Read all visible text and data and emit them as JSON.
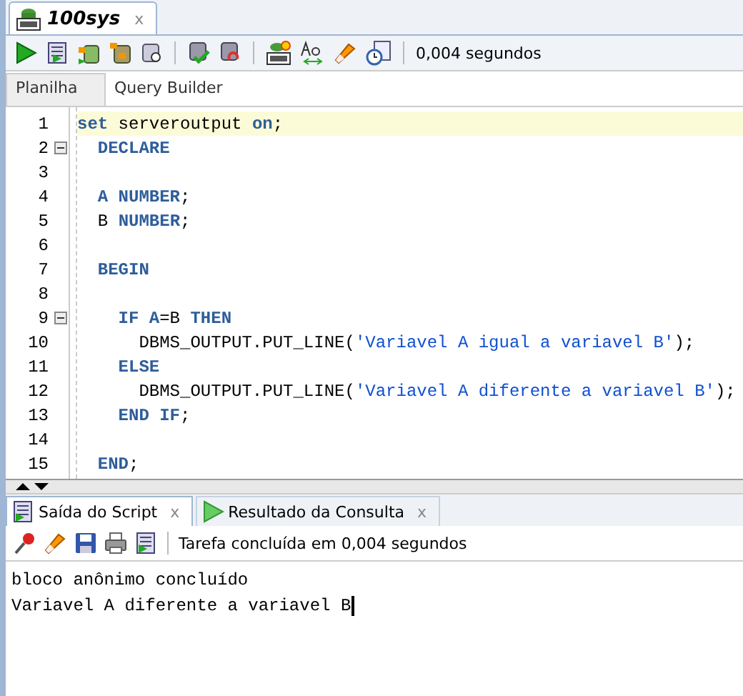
{
  "editor_tab": {
    "title": "100sys",
    "close": "x",
    "selected": true
  },
  "toolbar": {
    "timing": "0,004 segundos"
  },
  "sub_tabs": [
    {
      "label": "Planilha",
      "selected": true
    },
    {
      "label": "Query Builder",
      "selected": false
    }
  ],
  "code_lines": [
    {
      "number": "1",
      "fold": false,
      "highlighted": true,
      "tokens": [
        {
          "kind": "keyword",
          "text": "set"
        },
        {
          "kind": "text",
          "text": " serveroutput "
        },
        {
          "kind": "keyword",
          "text": "on"
        },
        {
          "kind": "text",
          "text": ";"
        }
      ]
    },
    {
      "number": "2",
      "fold": true,
      "highlighted": false,
      "tokens": [
        {
          "kind": "keyword",
          "text": "  DECLARE"
        }
      ]
    },
    {
      "number": "3",
      "fold": false,
      "highlighted": false
    },
    {
      "number": "4",
      "fold": false,
      "highlighted": false,
      "tokens": [
        {
          "kind": "keyword",
          "text": "  A NUMBER"
        },
        {
          "kind": "text",
          "text": ";"
        }
      ]
    },
    {
      "number": "5",
      "fold": false,
      "highlighted": false,
      "tokens": [
        {
          "kind": "text",
          "text": "  B "
        },
        {
          "kind": "keyword",
          "text": "NUMBER"
        },
        {
          "kind": "text",
          "text": ";"
        }
      ]
    },
    {
      "number": "6",
      "fold": false,
      "highlighted": false
    },
    {
      "number": "7",
      "fold": false,
      "highlighted": false,
      "tokens": [
        {
          "kind": "keyword",
          "text": "  BEGIN"
        }
      ]
    },
    {
      "number": "8",
      "fold": false,
      "highlighted": false
    },
    {
      "number": "9",
      "fold": true,
      "highlighted": false,
      "tokens": [
        {
          "kind": "keyword",
          "text": "    IF A"
        },
        {
          "kind": "text",
          "text": "=B "
        },
        {
          "kind": "keyword",
          "text": "THEN"
        }
      ]
    },
    {
      "number": "10",
      "fold": false,
      "highlighted": false,
      "tokens": [
        {
          "kind": "text",
          "text": "      DBMS_OUTPUT.PUT_LINE("
        },
        {
          "kind": "string",
          "text": "'Variavel A igual a variavel B'"
        },
        {
          "kind": "text",
          "text": ");"
        }
      ]
    },
    {
      "number": "11",
      "fold": false,
      "highlighted": false,
      "tokens": [
        {
          "kind": "keyword",
          "text": "    ELSE"
        }
      ]
    },
    {
      "number": "12",
      "fold": false,
      "highlighted": false,
      "tokens": [
        {
          "kind": "text",
          "text": "      DBMS_OUTPUT.PUT_LINE("
        },
        {
          "kind": "string",
          "text": "'Variavel A diferente a variavel B'"
        },
        {
          "kind": "text",
          "text": ");"
        }
      ]
    },
    {
      "number": "13",
      "fold": false,
      "highlighted": false,
      "tokens": [
        {
          "kind": "keyword",
          "text": "    END IF"
        },
        {
          "kind": "text",
          "text": ";"
        }
      ]
    },
    {
      "number": "14",
      "fold": false,
      "highlighted": false
    },
    {
      "number": "15",
      "fold": false,
      "highlighted": false,
      "tokens": [
        {
          "kind": "keyword",
          "text": "  END"
        },
        {
          "kind": "text",
          "text": ";"
        }
      ]
    }
  ],
  "output_tabs": [
    {
      "label": "Saída do Script",
      "close": "x",
      "selected": true
    },
    {
      "label": "Resultado da Consulta",
      "close": "x",
      "selected": false
    }
  ],
  "output_status": "Tarefa concluída em 0,004 segundos",
  "output_lines": [
    "bloco anônimo concluído",
    "Variavel A diferente a variavel B"
  ]
}
